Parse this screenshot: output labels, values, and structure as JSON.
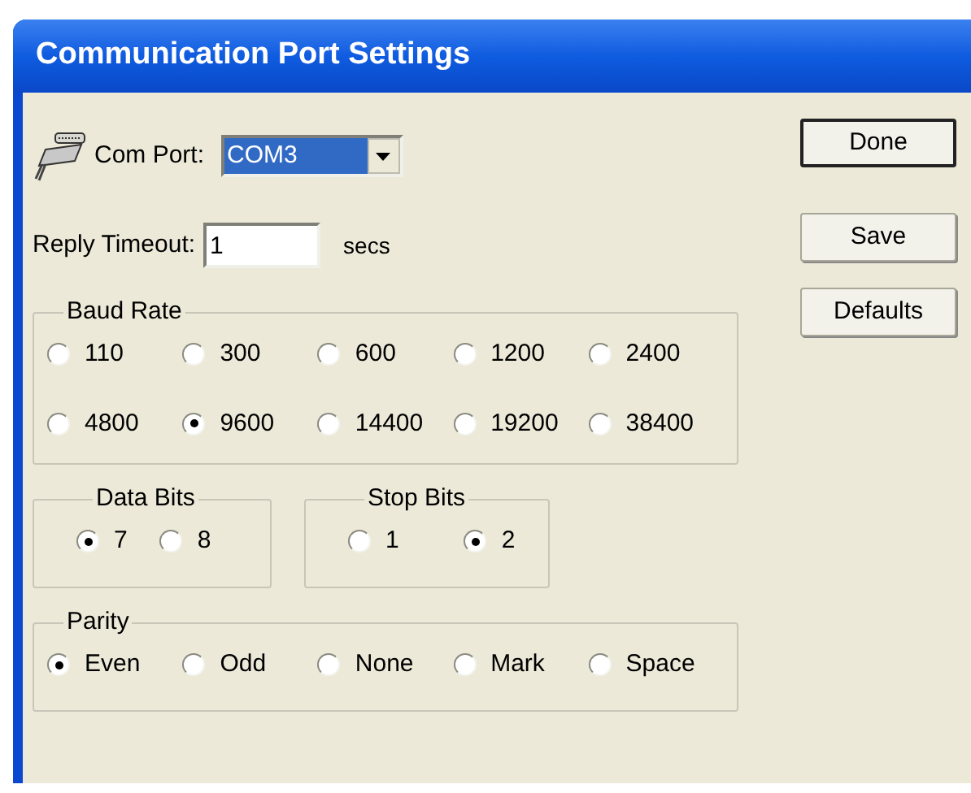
{
  "window": {
    "title": "Communication Port Settings"
  },
  "com_port": {
    "label": "Com Port:",
    "value": "COM3"
  },
  "reply_timeout": {
    "label": "Reply Timeout:",
    "value": "1",
    "unit": "secs"
  },
  "baud_rate": {
    "title": "Baud Rate",
    "options": [
      {
        "label": "110",
        "selected": false
      },
      {
        "label": "300",
        "selected": false
      },
      {
        "label": "600",
        "selected": false
      },
      {
        "label": "1200",
        "selected": false
      },
      {
        "label": "2400",
        "selected": false
      },
      {
        "label": "4800",
        "selected": false
      },
      {
        "label": "9600",
        "selected": true
      },
      {
        "label": "14400",
        "selected": false
      },
      {
        "label": "19200",
        "selected": false
      },
      {
        "label": "38400",
        "selected": false
      }
    ]
  },
  "data_bits": {
    "title": "Data Bits",
    "options": [
      {
        "label": "7",
        "selected": true
      },
      {
        "label": "8",
        "selected": false
      }
    ]
  },
  "stop_bits": {
    "title": "Stop Bits",
    "options": [
      {
        "label": "1",
        "selected": false
      },
      {
        "label": "2",
        "selected": true
      }
    ]
  },
  "parity": {
    "title": "Parity",
    "options": [
      {
        "label": "Even",
        "selected": true
      },
      {
        "label": "Odd",
        "selected": false
      },
      {
        "label": "None",
        "selected": false
      },
      {
        "label": "Mark",
        "selected": false
      },
      {
        "label": "Space",
        "selected": false
      }
    ]
  },
  "buttons": [
    {
      "label": "Done",
      "default": true
    },
    {
      "label": "Save",
      "default": false
    },
    {
      "label": "Defaults",
      "default": false
    }
  ]
}
